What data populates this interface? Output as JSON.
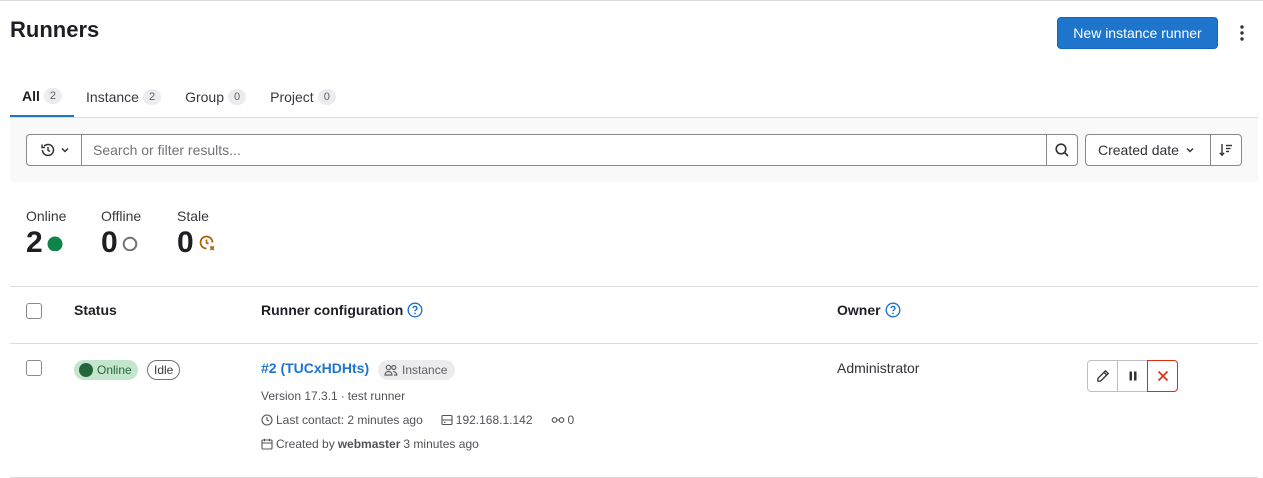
{
  "page": {
    "title": "Runners",
    "new_runner_label": "New instance runner"
  },
  "tabs": [
    {
      "label": "All",
      "count": "2",
      "active": true
    },
    {
      "label": "Instance",
      "count": "2"
    },
    {
      "label": "Group",
      "count": "0"
    },
    {
      "label": "Project",
      "count": "0"
    }
  ],
  "filter": {
    "search_placeholder": "Search or filter results...",
    "sort_label": "Created date"
  },
  "stats": {
    "online": {
      "label": "Online",
      "value": "2",
      "color": "#108548"
    },
    "offline": {
      "label": "Offline",
      "value": "0",
      "color": "#737278"
    },
    "stale": {
      "label": "Stale",
      "value": "0",
      "color": "#ab6100"
    }
  },
  "table": {
    "headers": {
      "status": "Status",
      "config": "Runner configuration",
      "owner": "Owner"
    },
    "rows": [
      {
        "status_online": "Online",
        "status_idle": "Idle",
        "runner_name": "#2 (TUCxHDHts)",
        "runner_type": "Instance",
        "version": "Version 17.3.1",
        "separator": "·",
        "description": "test runner",
        "last_contact": "Last contact: 2 minutes ago",
        "ip": "192.168.1.142",
        "jobs": "0",
        "created_prefix": "Created by",
        "created_by": "webmaster",
        "created_ago": "3 minutes ago",
        "owner": "Administrator"
      }
    ]
  }
}
